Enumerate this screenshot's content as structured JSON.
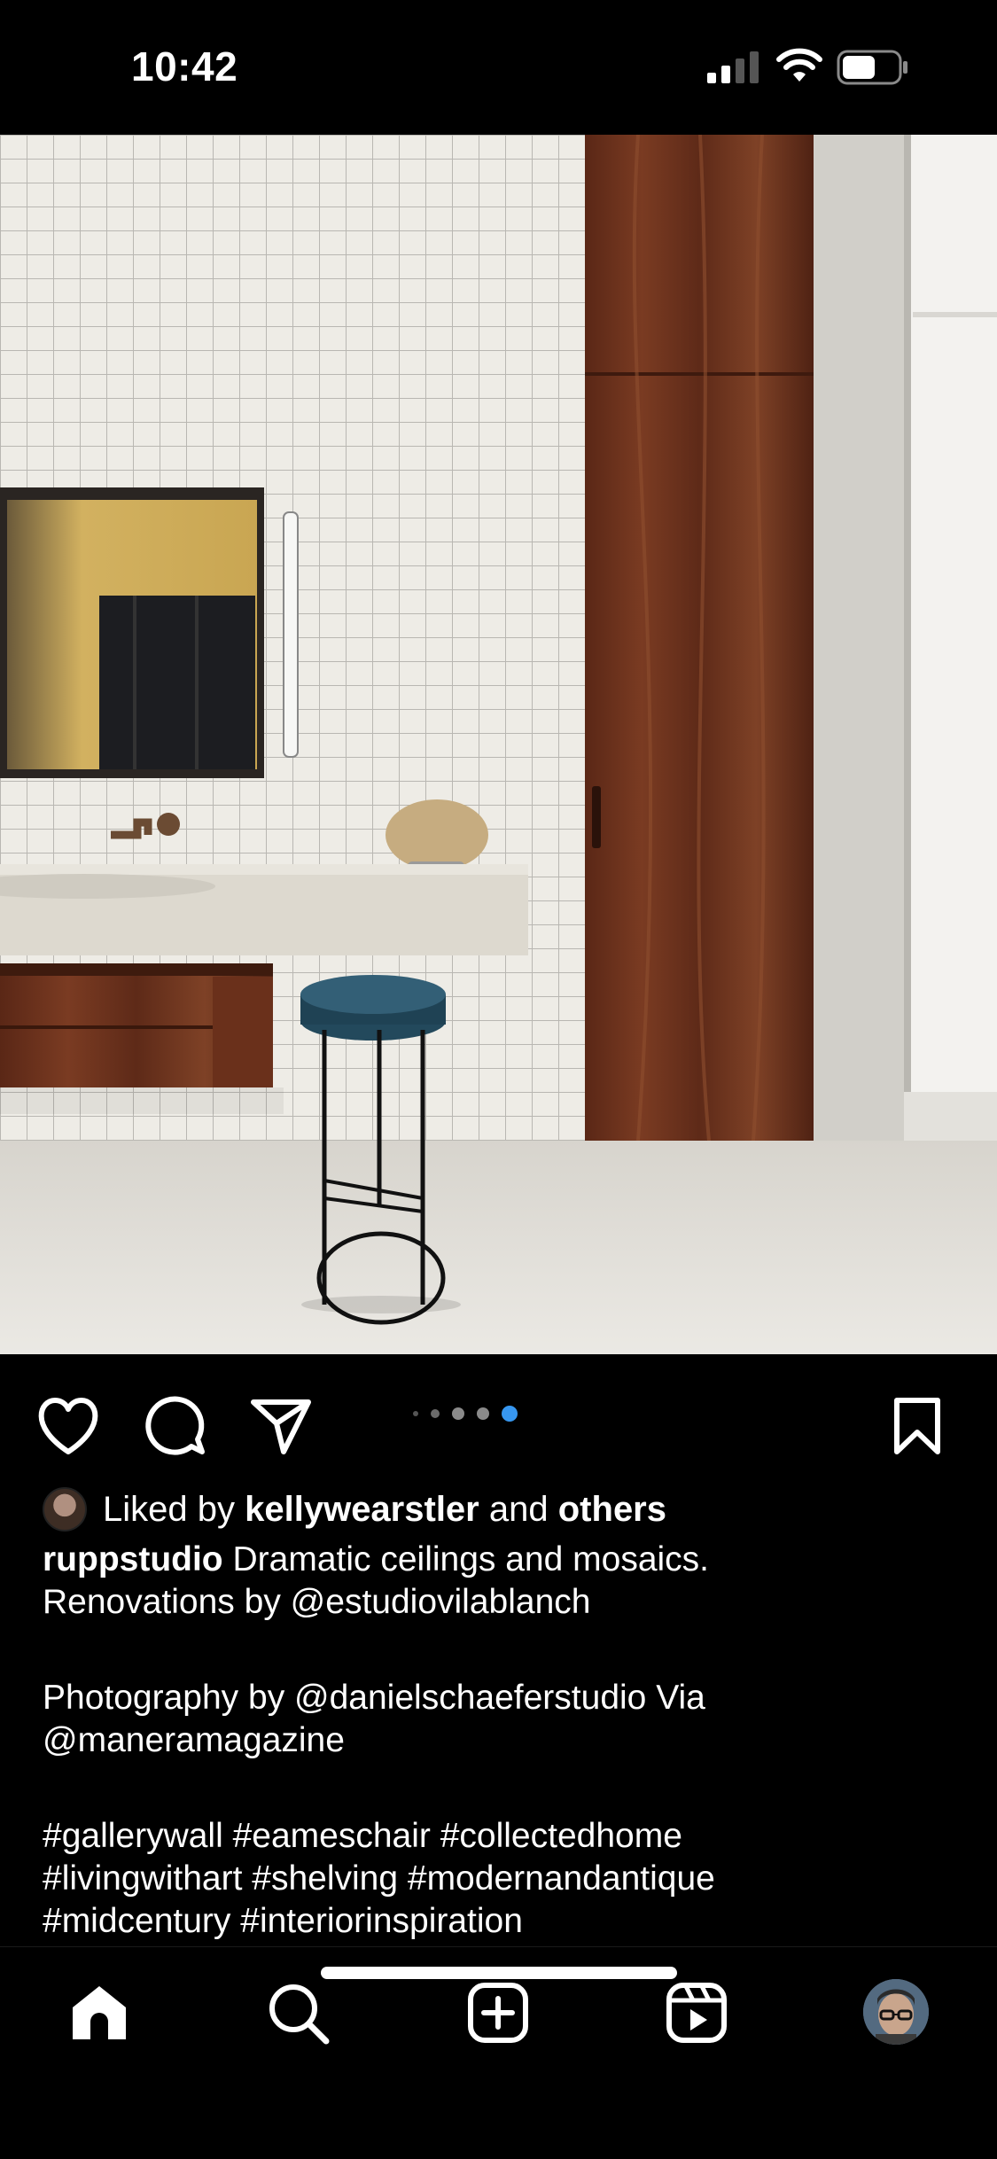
{
  "status_bar": {
    "time": "10:42"
  },
  "post": {
    "carousel": {
      "total": 5,
      "active_index": 4
    },
    "likes": {
      "prefix": "Liked by",
      "user": "kellywearstler",
      "joiner": "and",
      "suffix": "others"
    },
    "caption": {
      "username": "ruppstudio",
      "line1": "Dramatic ceilings and mosaics.",
      "line2": "Renovations by @estudiovilablanch",
      "line3": "Photography by @danielschaeferstudio Via",
      "line4": "@maneramagazine",
      "line5": "#gallerywall #eameschair #collectedhome",
      "line6": "#livingwithart #shelving #modernandantique",
      "line7": "#midcentury #interiorinspiration"
    }
  },
  "icons": {
    "like": "heart-icon",
    "comment": "comment-icon",
    "share": "paper-plane-icon",
    "save": "bookmark-icon",
    "home": "home-icon",
    "search": "search-icon",
    "create": "plus-square-icon",
    "reels": "reels-icon"
  },
  "colors": {
    "background": "#000000",
    "accent": "#3797f0",
    "text": "#ffffff"
  }
}
